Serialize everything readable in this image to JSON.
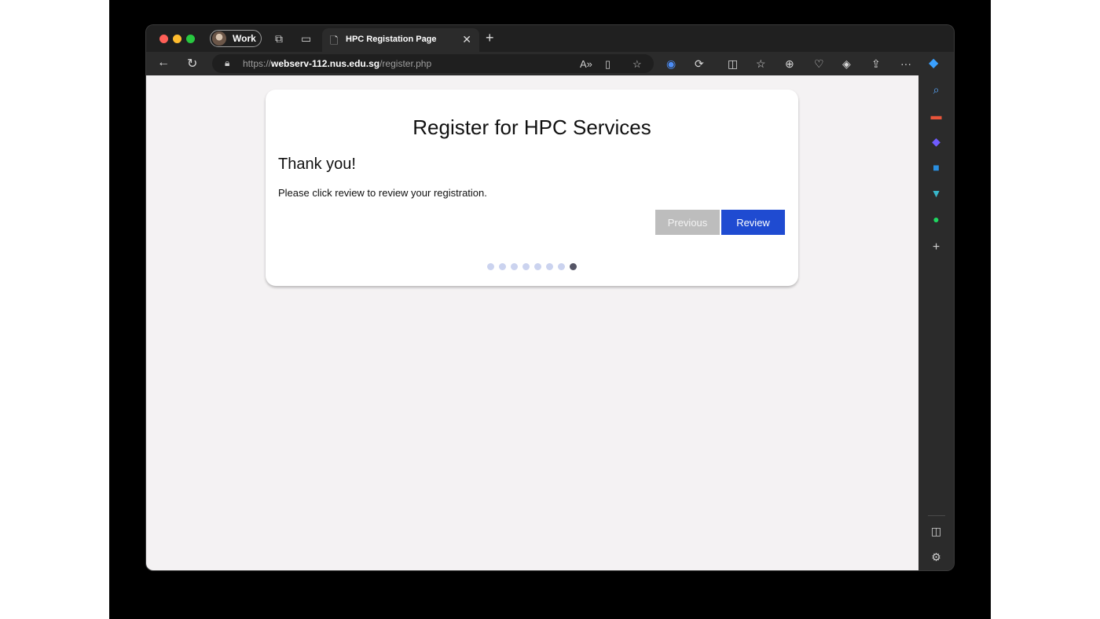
{
  "browser": {
    "profile_label": "Work",
    "tab_title": "HPC Registation Page",
    "url_scheme": "https://",
    "url_host": "webserv-112.nus.edu.sg",
    "url_path": "/register.php",
    "icons": {
      "back": "arrow-left-icon",
      "refresh": "refresh-icon",
      "lock": "lock-icon",
      "read_aloud": "read-aloud-icon",
      "reading_view": "immersive-reader-icon",
      "favorite": "star-icon",
      "password_manager": "1password-icon",
      "extensions": "extensions-icon",
      "split_screen": "split-screen-icon",
      "favorites": "favorites-icon",
      "collections": "collections-icon",
      "health": "browser-essentials-icon",
      "copilot_tool": "performance-icon",
      "share": "share-icon",
      "more": "more-icon",
      "copilot": "copilot-icon"
    }
  },
  "sidebar": {
    "items": [
      "search-icon",
      "tools-icon",
      "copilot-icon",
      "outlook-icon",
      "send-icon",
      "spotify-icon",
      "add-icon"
    ],
    "bottom": [
      "sidebar-toggle-icon",
      "settings-icon"
    ]
  },
  "page": {
    "heading": "Register for HPC Services",
    "subheading": "Thank you!",
    "message": "Please click review to review your registration.",
    "previous_label": "Previous",
    "review_label": "Review",
    "steps_total": 8,
    "current_step": 8
  },
  "colors": {
    "review_button": "#1f4bd1",
    "previous_button": "#bdbdbd",
    "step_dot_inactive": "#cbd3ef",
    "step_dot_active": "#555566"
  }
}
